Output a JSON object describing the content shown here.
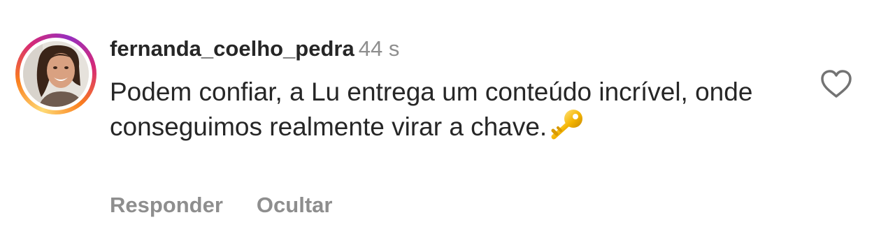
{
  "comment": {
    "username": "fernanda_coelho_pedra",
    "timestamp": "44 s",
    "text": "Podem confiar, a Lu entrega um conteúdo incrível, onde conseguimos realmente virar a chave.",
    "emoji": "key-emoji",
    "liked": false,
    "avatar_has_story_ring": true
  },
  "actions": {
    "reply_label": "Responder",
    "hide_label": "Ocultar"
  },
  "icons": {
    "like": "heart-outline-icon",
    "emoji": "key-emoji"
  },
  "colors": {
    "text": "#262626",
    "secondary": "#8e8e8e",
    "ring_start": "#feda75",
    "ring_mid": "#d62976",
    "ring_end": "#962fbf"
  }
}
